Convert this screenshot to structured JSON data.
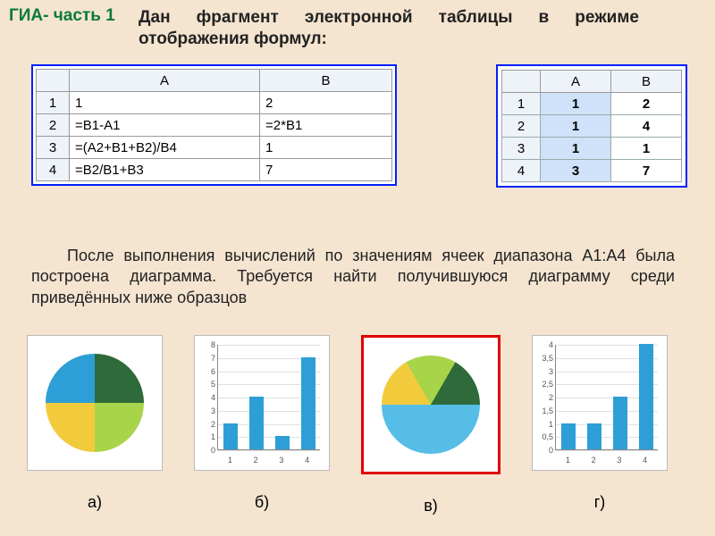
{
  "header": "ГИА- часть 1",
  "title": "Дан фрагмент электронной таблицы в режиме отображения формул:",
  "paragraph": "После выполнения вычислений по значениям ячеек диапазона А1:А4 была построена диаграмма. Требуется найти получившуюся диаграмму среди приведённых ниже образцов",
  "formula_table": {
    "col_headers": [
      "A",
      "B"
    ],
    "rows": [
      {
        "n": "1",
        "A": "1",
        "B": "2"
      },
      {
        "n": "2",
        "A": "=B1-A1",
        "B": "=2*B1"
      },
      {
        "n": "3",
        "A": "=(A2+B1+B2)/B4",
        "B": "1"
      },
      {
        "n": "4",
        "A": "=B2/B1+B3",
        "B": "7"
      }
    ]
  },
  "values_table": {
    "col_headers": [
      "A",
      "B"
    ],
    "rows": [
      {
        "n": "1",
        "A": "1",
        "B": "2"
      },
      {
        "n": "2",
        "A": "1",
        "B": "4"
      },
      {
        "n": "3",
        "A": "1",
        "B": "1"
      },
      {
        "n": "4",
        "A": "3",
        "B": "7"
      }
    ]
  },
  "options": {
    "labels": [
      "а)",
      "б)",
      "в)",
      "г)"
    ],
    "correct_index": 2
  },
  "chart_data": [
    {
      "type": "pie",
      "title": "",
      "values": [
        1,
        1,
        1,
        1
      ],
      "colors": [
        "#2d9fd6",
        "#2f6a3a",
        "#a8d44a",
        "#f2cb3c"
      ]
    },
    {
      "type": "bar",
      "categories": [
        "1",
        "2",
        "3",
        "4"
      ],
      "values": [
        2,
        4,
        1,
        7
      ],
      "ylim": [
        0,
        8
      ],
      "ticks": [
        0,
        1,
        2,
        3,
        4,
        5,
        6,
        7,
        8
      ]
    },
    {
      "type": "pie",
      "title": "",
      "values": [
        1,
        1,
        1,
        3
      ],
      "colors": [
        "#f2cb3c",
        "#a8d44a",
        "#2f6a3a",
        "#56bde6"
      ]
    },
    {
      "type": "bar",
      "categories": [
        "1",
        "2",
        "3",
        "4"
      ],
      "values": [
        1,
        1,
        2,
        4
      ],
      "ylim": [
        0,
        4
      ],
      "ticks": [
        0,
        0.5,
        1,
        1.5,
        2,
        2.5,
        3,
        3.5,
        4
      ]
    }
  ]
}
